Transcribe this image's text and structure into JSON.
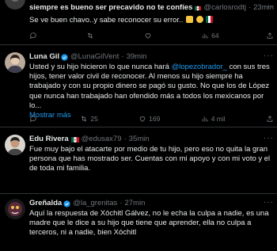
{
  "tweets": [
    {
      "name": "siempre es bueno ser precavido no te confíes",
      "handle": "@carlosrodtj",
      "time": "23min",
      "separator": "·",
      "text": "Se ve buen chavo..y sabe reconocer su error..",
      "reply_count": "",
      "retweet_count": "",
      "like_count": "",
      "view_count": "64"
    },
    {
      "name": "Luna Gil",
      "handle": "@LunaGilVent",
      "time": "39min",
      "separator": "·",
      "text_before": "Usted y su hijo hicieron lo que nunca hará ",
      "mention": "@lopezobrador_",
      "text_after": " con sus tres hijos, tener valor civil de reconocer. Al menos su hijo siempre ha trabajado y con su propio dinero se pagó su gusto. No que los de López que nunca han trabajado han ofendido más a todos los mexicanos por lo...",
      "show_more": "Mostrar más",
      "reply_count": "",
      "retweet_count": "25",
      "like_count": "169",
      "view_count": "4 mil"
    },
    {
      "name": "Edu Rivera",
      "handle": "@edusax79",
      "time": "35min",
      "separator": "·",
      "text": "Fue muy bajo el atacarte por medio de tu hijo, pero eso no quita la gran persona que has mostrado ser. Cuentas con mi apoyo y con mi voto y el de toda mi familia.",
      "reply_count": "",
      "retweet_count": "",
      "like_count": "",
      "view_count": ""
    },
    {
      "name": "Greñalda",
      "handle": "@la_grenitas",
      "time": "27min",
      "separator": "·",
      "text": "Aquí la respuesta de Xóchitl Gálvez, no le echa la culpa a nadie, es una madre que le dice a su hijo que tiene que aprender, ella no culpa a terceros, ni a nadie, bien Xóchitl",
      "reply_count": "",
      "retweet_count": "",
      "like_count": "",
      "view_count": ""
    }
  ],
  "colors": {
    "background": "#000000",
    "text": "#e7e9ea",
    "muted": "#71767b",
    "accent": "#1d9bf0",
    "divider": "#2f3336"
  },
  "icons": [
    "more-icon",
    "verified-badge-icon",
    "mexico-flag-icon",
    "reply-icon",
    "retweet-icon",
    "like-icon",
    "views-icon"
  ]
}
